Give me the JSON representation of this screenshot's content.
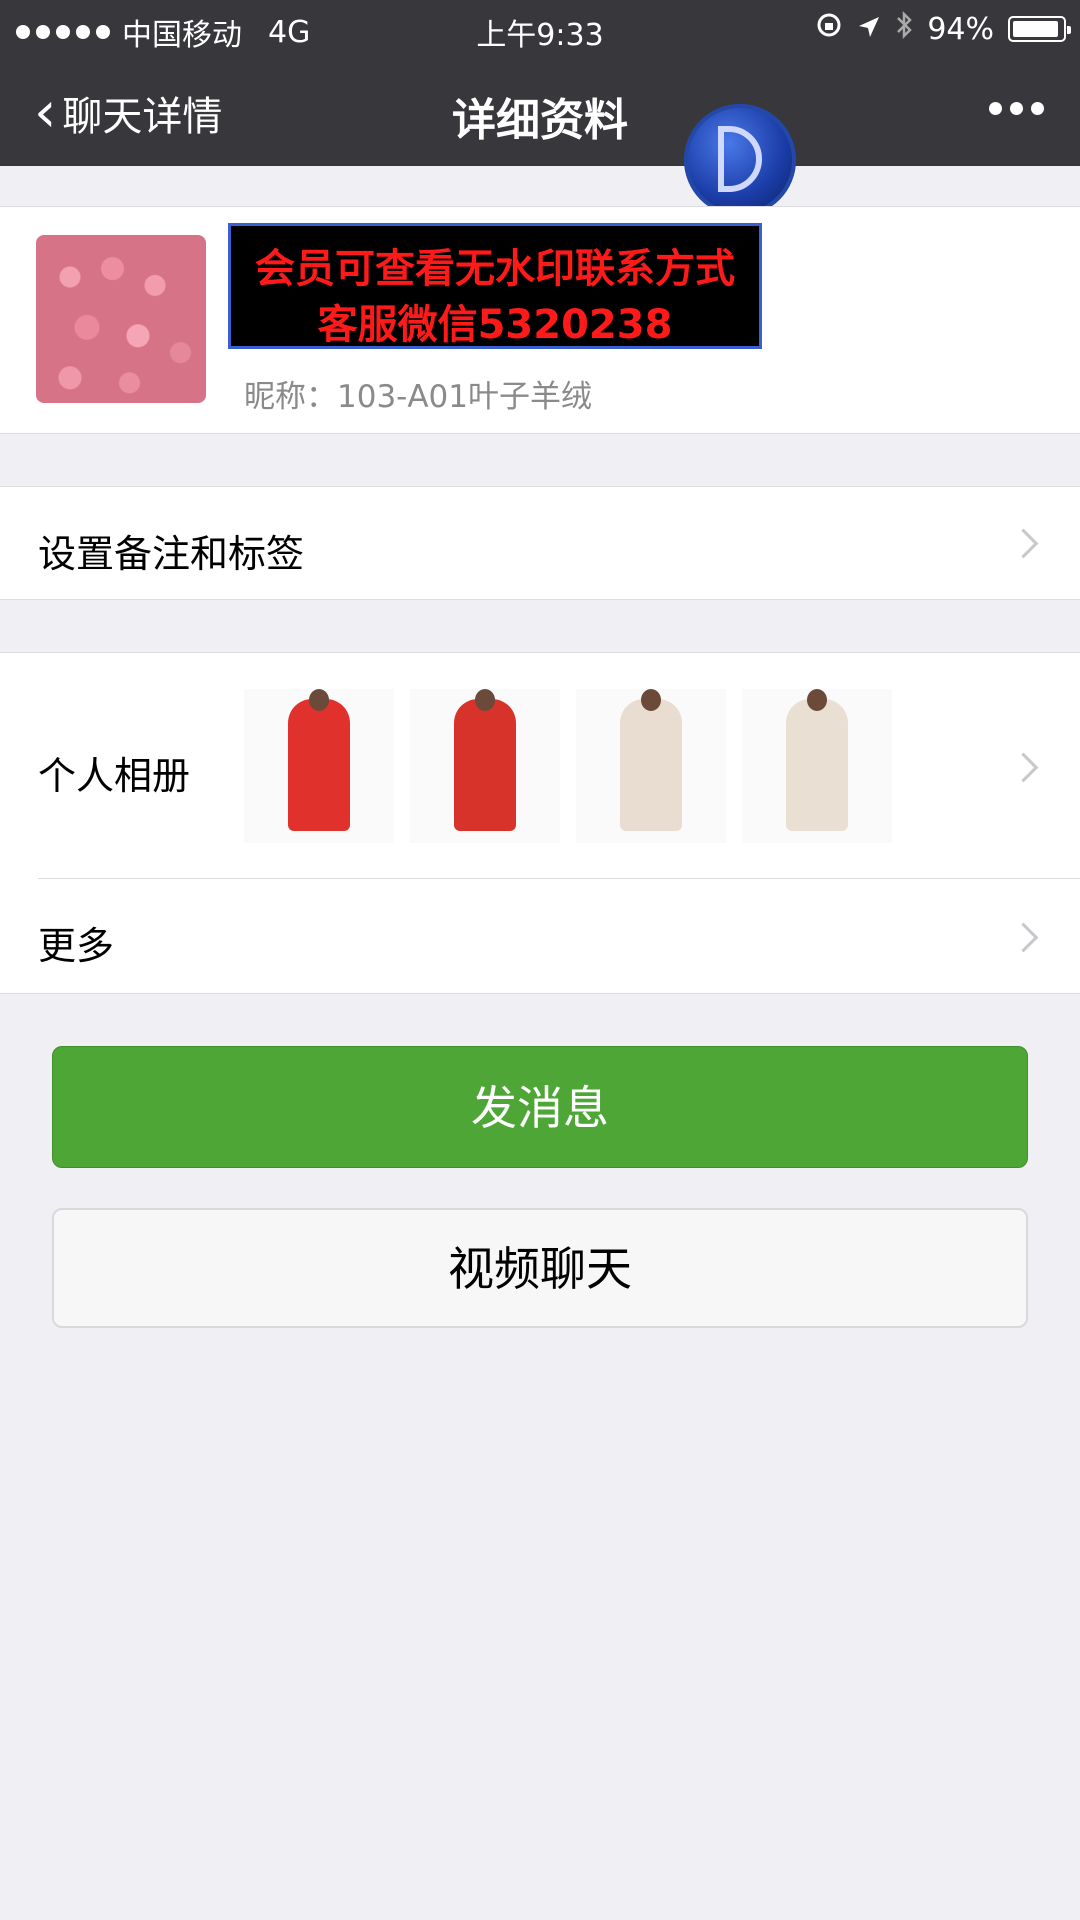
{
  "status_bar": {
    "carrier": "中国移动",
    "network": "4G",
    "time": "上午9:33",
    "battery_text": "94%",
    "battery_level": 0.94
  },
  "nav": {
    "back_label": "聊天详情",
    "title": "详细资料"
  },
  "profile": {
    "watermark_line1": "会员可查看无水印联系方式",
    "watermark_line2": "客服微信5320238",
    "nickname": "昵称：103-A01叶子羊绒"
  },
  "cells": {
    "remark_label": "设置备注和标签",
    "album_label": "个人相册",
    "more_label": "更多"
  },
  "album_photos": [
    {
      "coat_color": "#e0312c"
    },
    {
      "coat_color": "#d8332b"
    },
    {
      "coat_color": "#e8ddd0"
    },
    {
      "coat_color": "#eadfd3"
    }
  ],
  "buttons": {
    "send_message": "发消息",
    "video_chat": "视频聊天"
  },
  "colors": {
    "nav_bg": "#38373c",
    "primary_green": "#4ea636",
    "page_bg": "#efeff4",
    "watermark_red": "#ff1a1a"
  }
}
